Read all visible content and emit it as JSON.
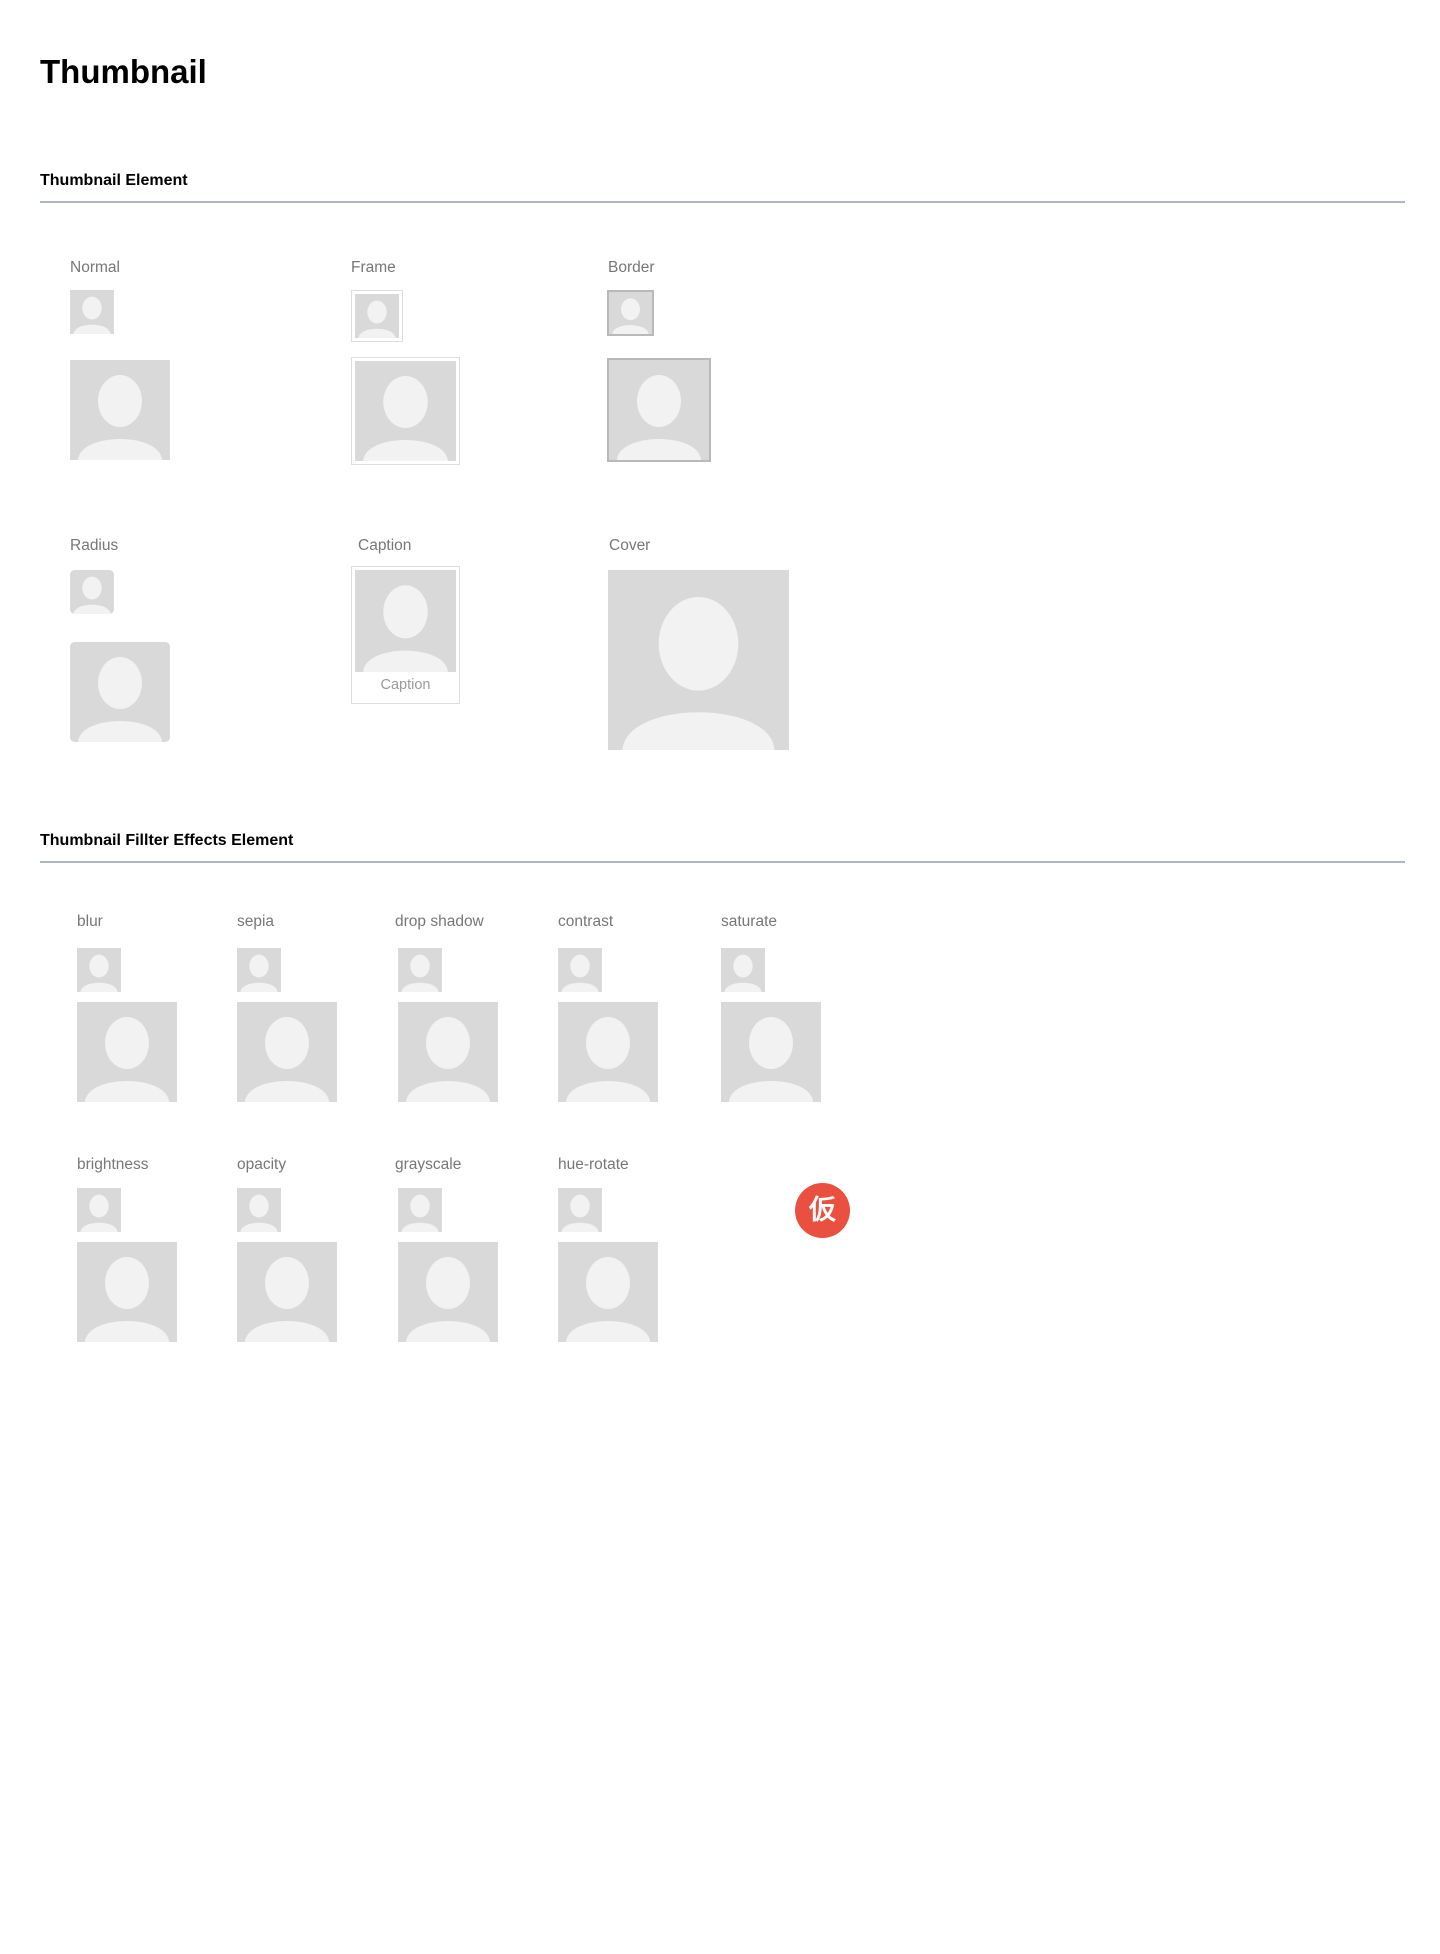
{
  "page": {
    "title": "Thumbnail"
  },
  "sections": {
    "element": {
      "heading": "Thumbnail Element",
      "items": {
        "normal": "Normal",
        "frame": "Frame",
        "border": "Border",
        "radius": "Radius",
        "caption": "Caption",
        "caption_text": "Caption",
        "cover": "Cover"
      }
    },
    "filters": {
      "heading": "Thumbnail Fillter Effects Element",
      "items": {
        "blur": "blur",
        "sepia": "sepia",
        "drop_shadow": "drop shadow",
        "contrast": "contrast",
        "saturate": "saturate",
        "brightness": "brightness",
        "opacity": "opacity",
        "grayscale": "grayscale",
        "hue_rotate": "hue-rotate"
      }
    }
  },
  "badge": {
    "text": "仮"
  },
  "icons": {
    "thumbnail": "person-placeholder-icon"
  },
  "colors": {
    "placeholder_bg": "#d9d9d9",
    "placeholder_figure": "#f2f2f2",
    "label": "#777777",
    "divider": "#aeb6c6",
    "badge": "#e9503f"
  }
}
